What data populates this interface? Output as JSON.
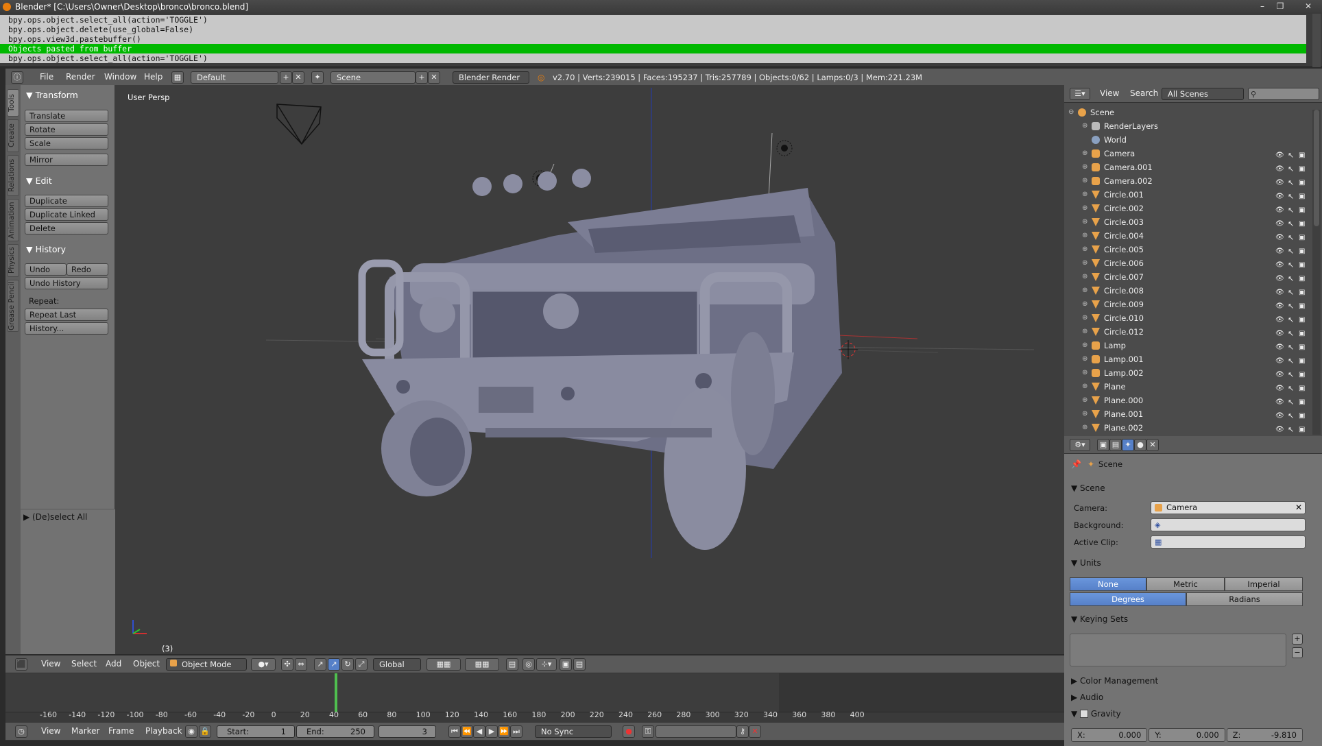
{
  "window": {
    "title": "Blender* [C:\\Users\\Owner\\Desktop\\bronco\\bronco.blend]",
    "buttons": [
      "–",
      "❐",
      "✕"
    ]
  },
  "console": {
    "lines": [
      {
        "text": "bpy.ops.object.select_all(action='TOGGLE')",
        "highlight": false
      },
      {
        "text": "bpy.ops.object.delete(use_global=False)",
        "highlight": false
      },
      {
        "text": "bpy.ops.view3d.pastebuffer()",
        "highlight": false
      },
      {
        "text": "Objects pasted from buffer",
        "highlight": true
      },
      {
        "text": "bpy.ops.object.select_all(action='TOGGLE')",
        "highlight": false
      }
    ]
  },
  "info_header": {
    "menus": [
      "File",
      "Render",
      "Window",
      "Help"
    ],
    "layout": "Default",
    "scene": "Scene",
    "engine": "Blender Render",
    "stats": "v2.70 | Verts:239015 | Faces:195237 | Tris:257789 | Objects:0/62 | Lamps:0/3 | Mem:221.23M"
  },
  "toolshelf": {
    "tabs": [
      "Tools",
      "Create",
      "Relations",
      "Animation",
      "Physics",
      "Grease Pencil"
    ],
    "transform": {
      "title": "Transform",
      "buttons": [
        "Translate",
        "Rotate",
        "Scale",
        "Mirror"
      ]
    },
    "edit": {
      "title": "Edit",
      "buttons": [
        "Duplicate",
        "Duplicate Linked",
        "Delete"
      ]
    },
    "history": {
      "title": "History",
      "undo": "Undo",
      "redo": "Redo",
      "undo_history": "Undo History",
      "repeat_label": "Repeat:",
      "repeat_last": "Repeat Last",
      "history": "History..."
    },
    "operator": "(De)select All"
  },
  "viewport": {
    "label": "User Persp",
    "frame_indicator": "(3)",
    "header": {
      "menus": [
        "View",
        "Select",
        "Add",
        "Object"
      ],
      "mode": "Object Mode",
      "orientation": "Global"
    }
  },
  "outliner": {
    "header": {
      "menus": [
        "View",
        "Search"
      ],
      "filter": "All Scenes"
    },
    "root": "Scene",
    "items": [
      {
        "name": "RenderLayers",
        "type": "renderlayers",
        "visible_icons": false
      },
      {
        "name": "World",
        "type": "world",
        "visible_icons": false
      },
      {
        "name": "Camera",
        "type": "camera",
        "visible_icons": true
      },
      {
        "name": "Camera.001",
        "type": "camera",
        "visible_icons": true
      },
      {
        "name": "Camera.002",
        "type": "camera",
        "visible_icons": true
      },
      {
        "name": "Circle.001",
        "type": "mesh",
        "visible_icons": true
      },
      {
        "name": "Circle.002",
        "type": "mesh",
        "visible_icons": true
      },
      {
        "name": "Circle.003",
        "type": "mesh",
        "visible_icons": true
      },
      {
        "name": "Circle.004",
        "type": "mesh",
        "visible_icons": true
      },
      {
        "name": "Circle.005",
        "type": "mesh",
        "visible_icons": true
      },
      {
        "name": "Circle.006",
        "type": "mesh",
        "visible_icons": true
      },
      {
        "name": "Circle.007",
        "type": "mesh",
        "visible_icons": true
      },
      {
        "name": "Circle.008",
        "type": "mesh",
        "visible_icons": true
      },
      {
        "name": "Circle.009",
        "type": "mesh",
        "visible_icons": true
      },
      {
        "name": "Circle.010",
        "type": "mesh",
        "visible_icons": true
      },
      {
        "name": "Circle.012",
        "type": "mesh",
        "visible_icons": true
      },
      {
        "name": "Lamp",
        "type": "lamp",
        "visible_icons": true
      },
      {
        "name": "Lamp.001",
        "type": "lamp",
        "visible_icons": true
      },
      {
        "name": "Lamp.002",
        "type": "lamp",
        "visible_icons": true
      },
      {
        "name": "Plane",
        "type": "mesh",
        "visible_icons": true
      },
      {
        "name": "Plane.000",
        "type": "mesh",
        "visible_icons": true
      },
      {
        "name": "Plane.001",
        "type": "mesh",
        "visible_icons": true
      },
      {
        "name": "Plane.002",
        "type": "mesh",
        "visible_icons": true
      }
    ]
  },
  "properties": {
    "breadcrumb": "Scene",
    "scene_panel": {
      "title": "Scene",
      "camera_label": "Camera:",
      "camera_value": "Camera",
      "background_label": "Background:",
      "active_clip_label": "Active Clip:"
    },
    "units_panel": {
      "title": "Units",
      "systems": [
        "None",
        "Metric",
        "Imperial"
      ],
      "active_system": "None",
      "rotation": [
        "Degrees",
        "Radians"
      ],
      "active_rotation": "Degrees"
    },
    "keying_sets": {
      "title": "Keying Sets"
    },
    "color_management": "Color Management",
    "audio": "Audio",
    "gravity": {
      "title": "Gravity",
      "x": "X:",
      "x_val": "0.000",
      "y": "Y:",
      "y_val": "0.000",
      "z": "Z:",
      "z_val": "-9.810"
    }
  },
  "timeline": {
    "ticks": [
      "-160",
      "-140",
      "-120",
      "-100",
      "-80",
      "-60",
      "-40",
      "-20",
      "0",
      "20",
      "40",
      "60",
      "80",
      "100",
      "120",
      "140",
      "160",
      "180",
      "200",
      "220",
      "240",
      "260",
      "280",
      "300",
      "320",
      "340",
      "360",
      "380",
      "400"
    ],
    "header": {
      "menus": [
        "View",
        "Marker",
        "Frame",
        "Playback"
      ],
      "start_label": "Start:",
      "start_value": "1",
      "end_label": "End:",
      "end_value": "250",
      "current": "3",
      "sync": "No Sync"
    }
  },
  "colors": {
    "accent": "#5680c8",
    "console_highlight": "#00b800",
    "mesh_icon": "#e8a24a"
  }
}
